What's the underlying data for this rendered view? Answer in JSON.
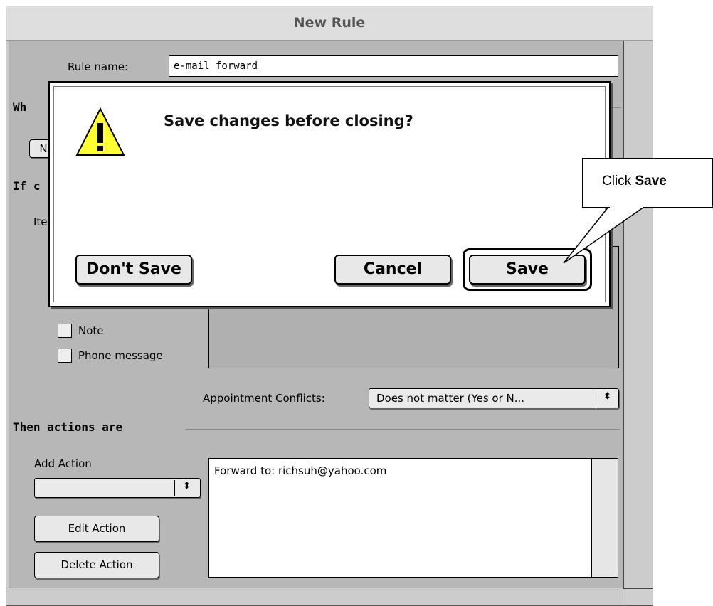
{
  "window": {
    "title": "New Rule"
  },
  "rule_name": {
    "label": "Rule name:",
    "value": "e-mail forward"
  },
  "sections": {
    "when": "Wh",
    "if": "If c",
    "then": "Then actions are"
  },
  "partial": {
    "n_button": "N",
    "items_label": "Ite"
  },
  "checkboxes": [
    {
      "label": "Note",
      "checked": false
    },
    {
      "label": "Phone message",
      "checked": false
    }
  ],
  "appointment_conflicts": {
    "label": "Appointment Conflicts:",
    "value": "Does not matter (Yes or N..."
  },
  "actions": {
    "add_label": "Add Action",
    "add_value": "",
    "edit_button": "Edit Action",
    "delete_button": "Delete Action",
    "list": [
      "Forward to: richsuh@yahoo.com"
    ]
  },
  "dialog": {
    "message": "Save changes before closing?",
    "icon": "warning-icon",
    "dont_save": "Don't Save",
    "cancel": "Cancel",
    "save": "Save"
  },
  "callout": {
    "prefix": "Click ",
    "emphasis": "Save"
  }
}
